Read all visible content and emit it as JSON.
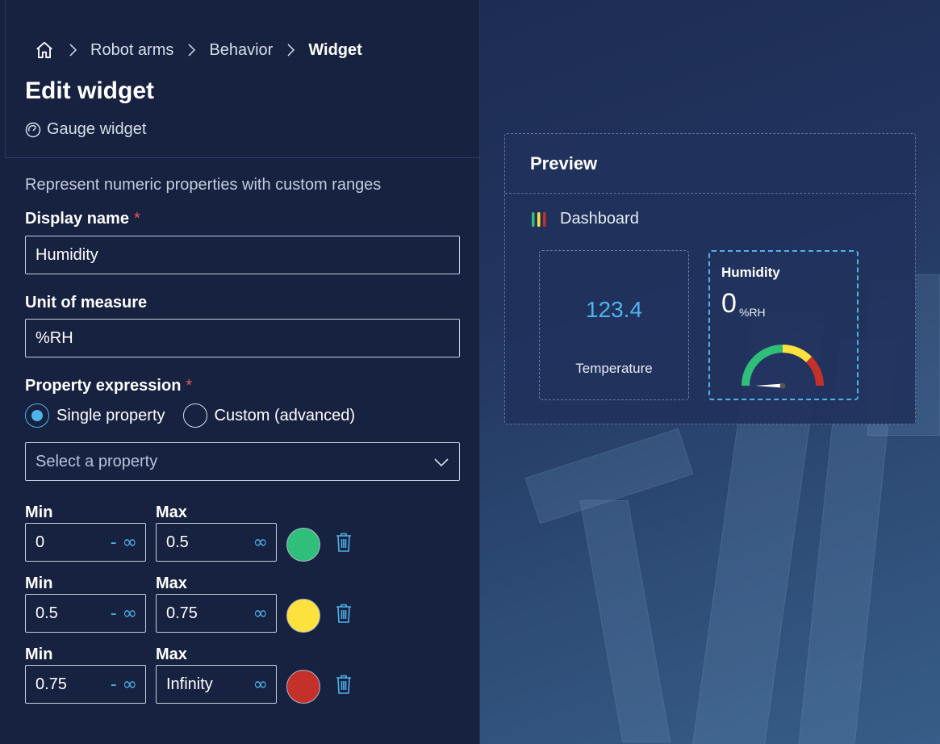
{
  "breadcrumb": {
    "items": [
      "Robot arms",
      "Behavior"
    ],
    "current": "Widget"
  },
  "page": {
    "title": "Edit widget",
    "subtitle": "Gauge widget",
    "description": "Represent numeric properties with custom ranges"
  },
  "form": {
    "display_name_label": "Display name",
    "display_name_value": "Humidity",
    "unit_label": "Unit of measure",
    "unit_value": "%RH",
    "expression_label": "Property expression",
    "required_mark": "*",
    "radio_single": "Single property",
    "radio_custom": "Custom (advanced)",
    "select_placeholder": "Select a property"
  },
  "ranges": [
    {
      "min_label": "Min",
      "max_label": "Max",
      "min": "0",
      "max": "0.5",
      "min_suffix": "- ∞",
      "max_suffix": "∞",
      "color": "#2fbf7a"
    },
    {
      "min_label": "Min",
      "max_label": "Max",
      "min": "0.5",
      "max": "0.75",
      "min_suffix": "- ∞",
      "max_suffix": "∞",
      "color": "#fde23e"
    },
    {
      "min_label": "Min",
      "max_label": "Max",
      "min": "0.75",
      "max": "Infinity",
      "min_suffix": "- ∞",
      "max_suffix": "∞",
      "color": "#c4312a"
    }
  ],
  "preview": {
    "title": "Preview",
    "dashboard_label": "Dashboard",
    "temp_value": "123.4",
    "temp_caption": "Temperature",
    "humidity_title": "Humidity",
    "humidity_value": "0",
    "humidity_unit": "%RH",
    "gauge_fraction": 0
  },
  "colors": {
    "accent": "#4fb3ea",
    "required": "#e35a5a"
  }
}
